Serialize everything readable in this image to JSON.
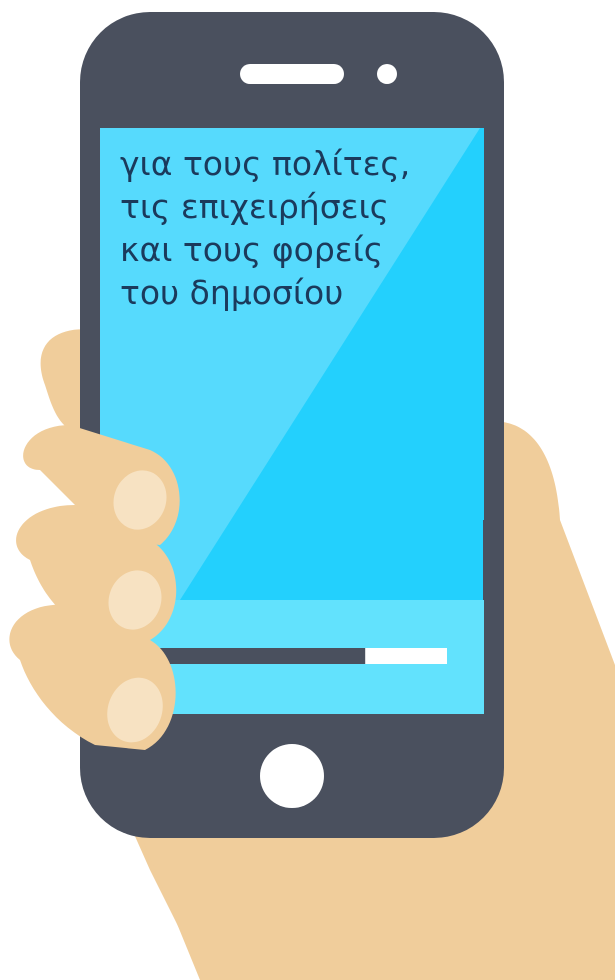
{
  "screen": {
    "lines": [
      "για τους πολίτες,",
      "τις επιχειρήσεις",
      "και τους φορείς",
      "του δημοσίου"
    ]
  },
  "progress": {
    "value": 0.72
  },
  "colors": {
    "phone_body": "#4a505e",
    "screen_top": "#23d0fd",
    "screen_bottom": "#62e2fd",
    "text": "#1b3a5c",
    "skin": "#f0cd9b",
    "nail": "#f7e2c2",
    "progress_fill": "#4a505e",
    "progress_track": "#ffffff"
  }
}
